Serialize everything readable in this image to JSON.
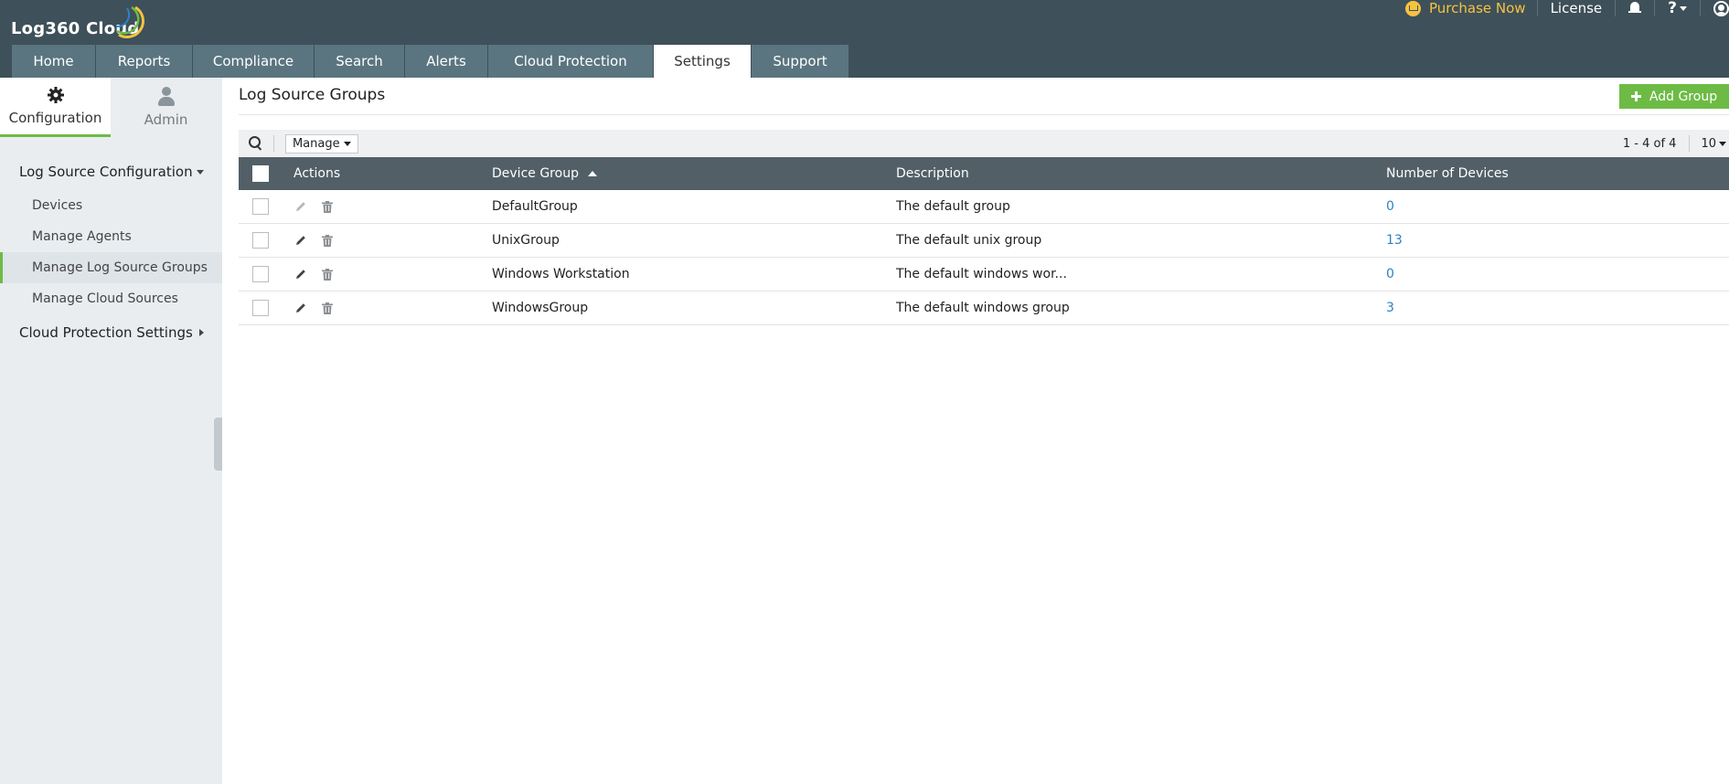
{
  "app": {
    "logo_text": "Log360 Cloud",
    "purchase_label": "Purchase Now",
    "license_label": "License",
    "help_label": "?"
  },
  "nav": {
    "tabs": [
      {
        "label": "Home"
      },
      {
        "label": "Reports"
      },
      {
        "label": "Compliance"
      },
      {
        "label": "Search"
      },
      {
        "label": "Alerts"
      },
      {
        "label": "Cloud Protection"
      },
      {
        "label": "Settings",
        "active": true
      },
      {
        "label": "Support"
      }
    ]
  },
  "sidebar": {
    "tabs": [
      {
        "label": "Configuration",
        "icon": "gear-icon",
        "active": true
      },
      {
        "label": "Admin",
        "icon": "user-icon"
      }
    ],
    "sections": [
      {
        "label": "Log Source Configuration",
        "expanded": true,
        "items": [
          {
            "label": "Devices"
          },
          {
            "label": "Manage Agents"
          },
          {
            "label": "Manage Log Source Groups",
            "active": true
          },
          {
            "label": "Manage Cloud Sources"
          }
        ]
      },
      {
        "label": "Cloud Protection Settings",
        "expanded": false
      }
    ]
  },
  "main": {
    "title": "Log Source Groups",
    "add_group_label": "Add Group",
    "toolbar": {
      "manage_label": "Manage",
      "range_label": "1 - 4 of 4",
      "page_size": "10"
    },
    "table": {
      "headers": {
        "actions": "Actions",
        "device_group": "Device Group",
        "description": "Description",
        "number_of_devices": "Number of Devices"
      },
      "rows": [
        {
          "device_group": "DefaultGroup",
          "description": "The default group",
          "number_of_devices": "0",
          "editable": false
        },
        {
          "device_group": "UnixGroup",
          "description": "The default unix group",
          "number_of_devices": "13",
          "editable": true
        },
        {
          "device_group": "Windows Workstation",
          "description": "The default windows wor...",
          "number_of_devices": "0",
          "editable": true
        },
        {
          "device_group": "WindowsGroup",
          "description": "The default windows group",
          "number_of_devices": "3",
          "editable": true
        }
      ]
    }
  },
  "colors": {
    "header_bg": "#3e5059",
    "tab_bg": "#5b7580",
    "accent_green": "#6dbb45",
    "purchase_yellow": "#f6c242",
    "link_blue": "#2a83c6",
    "table_header_bg": "#525f67"
  }
}
